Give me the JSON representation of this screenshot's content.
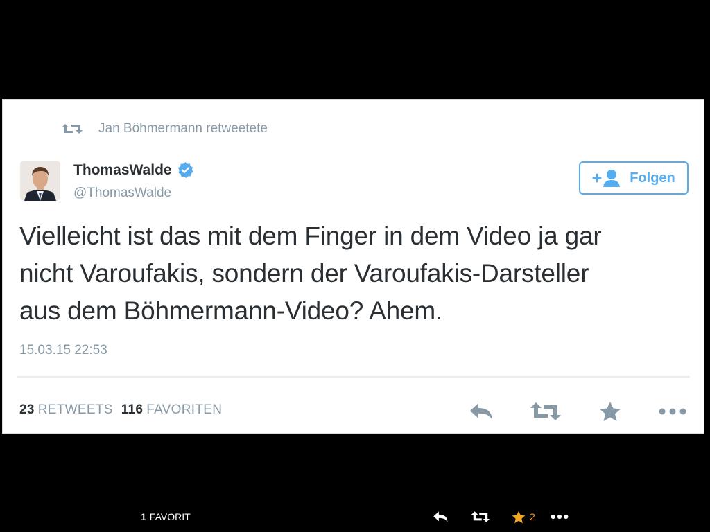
{
  "retweet_context": {
    "text": "Jan Böhmermann retweetete",
    "icon": "retweet-icon"
  },
  "author": {
    "name": "ThomasWalde",
    "handle": "@ThomasWalde",
    "verified": true,
    "verified_icon": "verified-badge-icon"
  },
  "follow_button": {
    "label": "Folgen",
    "icon": "add-user-icon"
  },
  "tweet": {
    "text_line1": "Vielleicht ist das mit dem Finger in dem Video ja gar",
    "text_line2": "nicht Varoufakis, sondern der Varoufakis-Darsteller",
    "text_line3": "aus dem Böhmermann-Video? Ahem.",
    "timestamp": "15.03.15 22:53"
  },
  "stats": {
    "retweets_count": "23",
    "retweets_label": "RETWEETS",
    "favorites_count": "116",
    "favorites_label": "FAVORITEN"
  },
  "actions": [
    "reply-icon",
    "retweet-icon",
    "favorite-star-icon",
    "more-dots-icon"
  ],
  "bottom_bar": {
    "favorit_count": "1",
    "favorit_label": "FAVORIT",
    "star_count": "2"
  },
  "colors": {
    "accent": "#55acee",
    "muted": "#8899a6",
    "text": "#292f33",
    "star_active": "#f5a623"
  }
}
